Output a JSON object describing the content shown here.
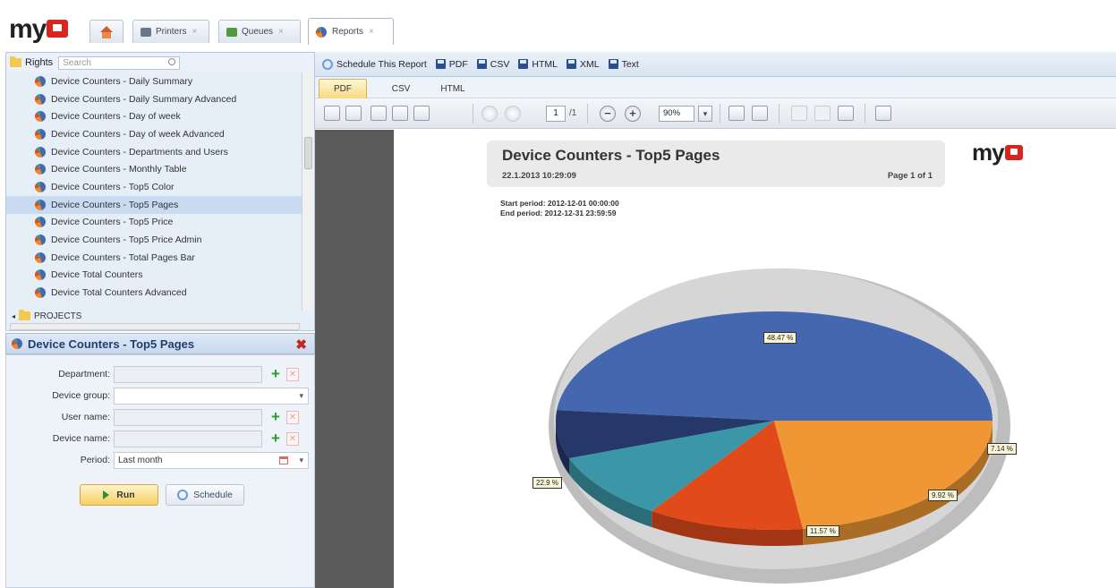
{
  "brand": {
    "logo_text": "my"
  },
  "tabs": [
    {
      "label": "Printers"
    },
    {
      "label": "Queues"
    },
    {
      "label": "Reports"
    }
  ],
  "tab_close": "×",
  "tree": {
    "root_label": "Rights",
    "search_placeholder": "Search",
    "items": [
      "Device Counters - Daily Summary",
      "Device Counters - Daily Summary Advanced",
      "Device Counters - Day of week",
      "Device Counters - Day of week Advanced",
      "Device Counters - Departments and Users",
      "Device Counters - Monthly Table",
      "Device Counters - Top5 Color",
      "Device Counters - Top5 Pages",
      "Device Counters - Top5 Price",
      "Device Counters - Top5 Price Admin",
      "Device Counters - Total Pages Bar",
      "Device Total Counters",
      "Device Total Counters Advanced"
    ],
    "selected_index": 7,
    "projects_label": "PROJECTS"
  },
  "form": {
    "title": "Device Counters - Top5 Pages",
    "close_glyph": "✖",
    "fields": [
      {
        "label": "Department:",
        "value": ""
      },
      {
        "label": "Device group:",
        "value": ""
      },
      {
        "label": "User name:",
        "value": ""
      },
      {
        "label": "Device name:",
        "value": ""
      },
      {
        "label": "Period:",
        "value": "Last month"
      }
    ],
    "add_glyph": "+",
    "remove_glyph": "✕",
    "dropdown_glyph": "▾",
    "run_label": "Run",
    "schedule_label": "Schedule"
  },
  "report_toolbar": {
    "schedule_label": "Schedule This Report",
    "exports": [
      "PDF",
      "CSV",
      "HTML",
      "XML",
      "Text"
    ]
  },
  "format_tabs": [
    "PDF",
    "CSV",
    "HTML"
  ],
  "pdf_toolbar": {
    "page": "1",
    "page_total": "/1",
    "zoom": "90%",
    "zoom_out": "−",
    "zoom_in": "+",
    "dropdown_glyph": "▾"
  },
  "report": {
    "title": "Device Counters - Top5 Pages",
    "date": "22.1.2013 10:29:09",
    "page_info": "Page 1 of 1",
    "start_period": "Start period: 2012-12-01 00:00:00",
    "end_period": "End period: 2012-12-31 23:59:59",
    "logo_text": "my"
  },
  "chart_data": {
    "type": "pie",
    "style": "3d",
    "values": [
      48.47,
      7.14,
      9.92,
      11.57,
      22.9
    ],
    "labels": [
      "48.47 %",
      "7.14 %",
      "9.92 %",
      "11.57 %",
      "22.9 %"
    ],
    "colors": [
      "#4467b0",
      "#26386a",
      "#3b97a8",
      "#e14b1c",
      "#ee9734"
    ],
    "title": ""
  },
  "colors": {
    "selection": "#c9dbf1",
    "brand_red": "#d6261f",
    "run_button": "#f6cf63"
  }
}
